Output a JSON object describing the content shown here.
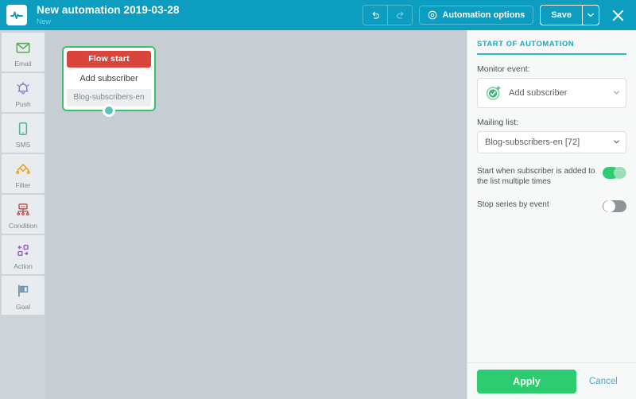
{
  "topbar": {
    "logo_icon": "pulse-logo-icon",
    "title": "New automation 2019-03-28",
    "subtitle": "New",
    "undo_icon": "undo-arrow-icon",
    "redo_icon": "redo-arrow-icon",
    "automation_options_label": "Automation options",
    "automation_options_icon": "gear-icon",
    "save_label": "Save",
    "save_caret_icon": "chevron-down-icon",
    "close_icon": "close-icon",
    "bg_color": "#0c9dc0"
  },
  "sidebar": {
    "items": [
      {
        "label": "Email",
        "icon": "envelope-icon",
        "color": "#5aa85a"
      },
      {
        "label": "Push",
        "icon": "bell-icon",
        "color": "#7b82c4"
      },
      {
        "label": "SMS",
        "icon": "mobile-phone-icon",
        "color": "#4fb3a8"
      },
      {
        "label": "Filter",
        "icon": "filter-funnel-icon",
        "color": "#e8a317"
      },
      {
        "label": "Condition",
        "icon": "condition-node-icon",
        "color": "#b5554f"
      },
      {
        "label": "Action",
        "icon": "action-swap-icon",
        "color": "#9b5cc4"
      },
      {
        "label": "Goal",
        "icon": "flag-icon",
        "color": "#6f8fa8"
      }
    ]
  },
  "canvas": {
    "node": {
      "header_label": "Flow start",
      "header_color": "#d9453c",
      "border_color": "#3ec16f",
      "title": "Add subscriber",
      "chip": "Blog-subscribers-en",
      "connector_icon": "node-connector-handle",
      "connector_color": "#5cc2b8"
    }
  },
  "panel": {
    "heading": "START OF AUTOMATION",
    "accent_color": "#2bb7cf",
    "monitor_event": {
      "label": "Monitor event:",
      "value": "Add subscriber",
      "icon": "add-subscriber-icon",
      "caret_icon": "chevron-down-icon"
    },
    "mailing_list": {
      "label": "Mailing list:",
      "value": "Blog-subscribers-en [72]",
      "caret_icon": "chevron-down-icon"
    },
    "toggles": [
      {
        "label": "Start when subscriber is added to the list multiple times",
        "state": "on"
      },
      {
        "label": "Stop series by event",
        "state": "off"
      }
    ],
    "footer": {
      "apply_label": "Apply",
      "apply_color": "#2ecc71",
      "cancel_label": "Cancel",
      "cancel_color": "#4aa8c9"
    }
  }
}
